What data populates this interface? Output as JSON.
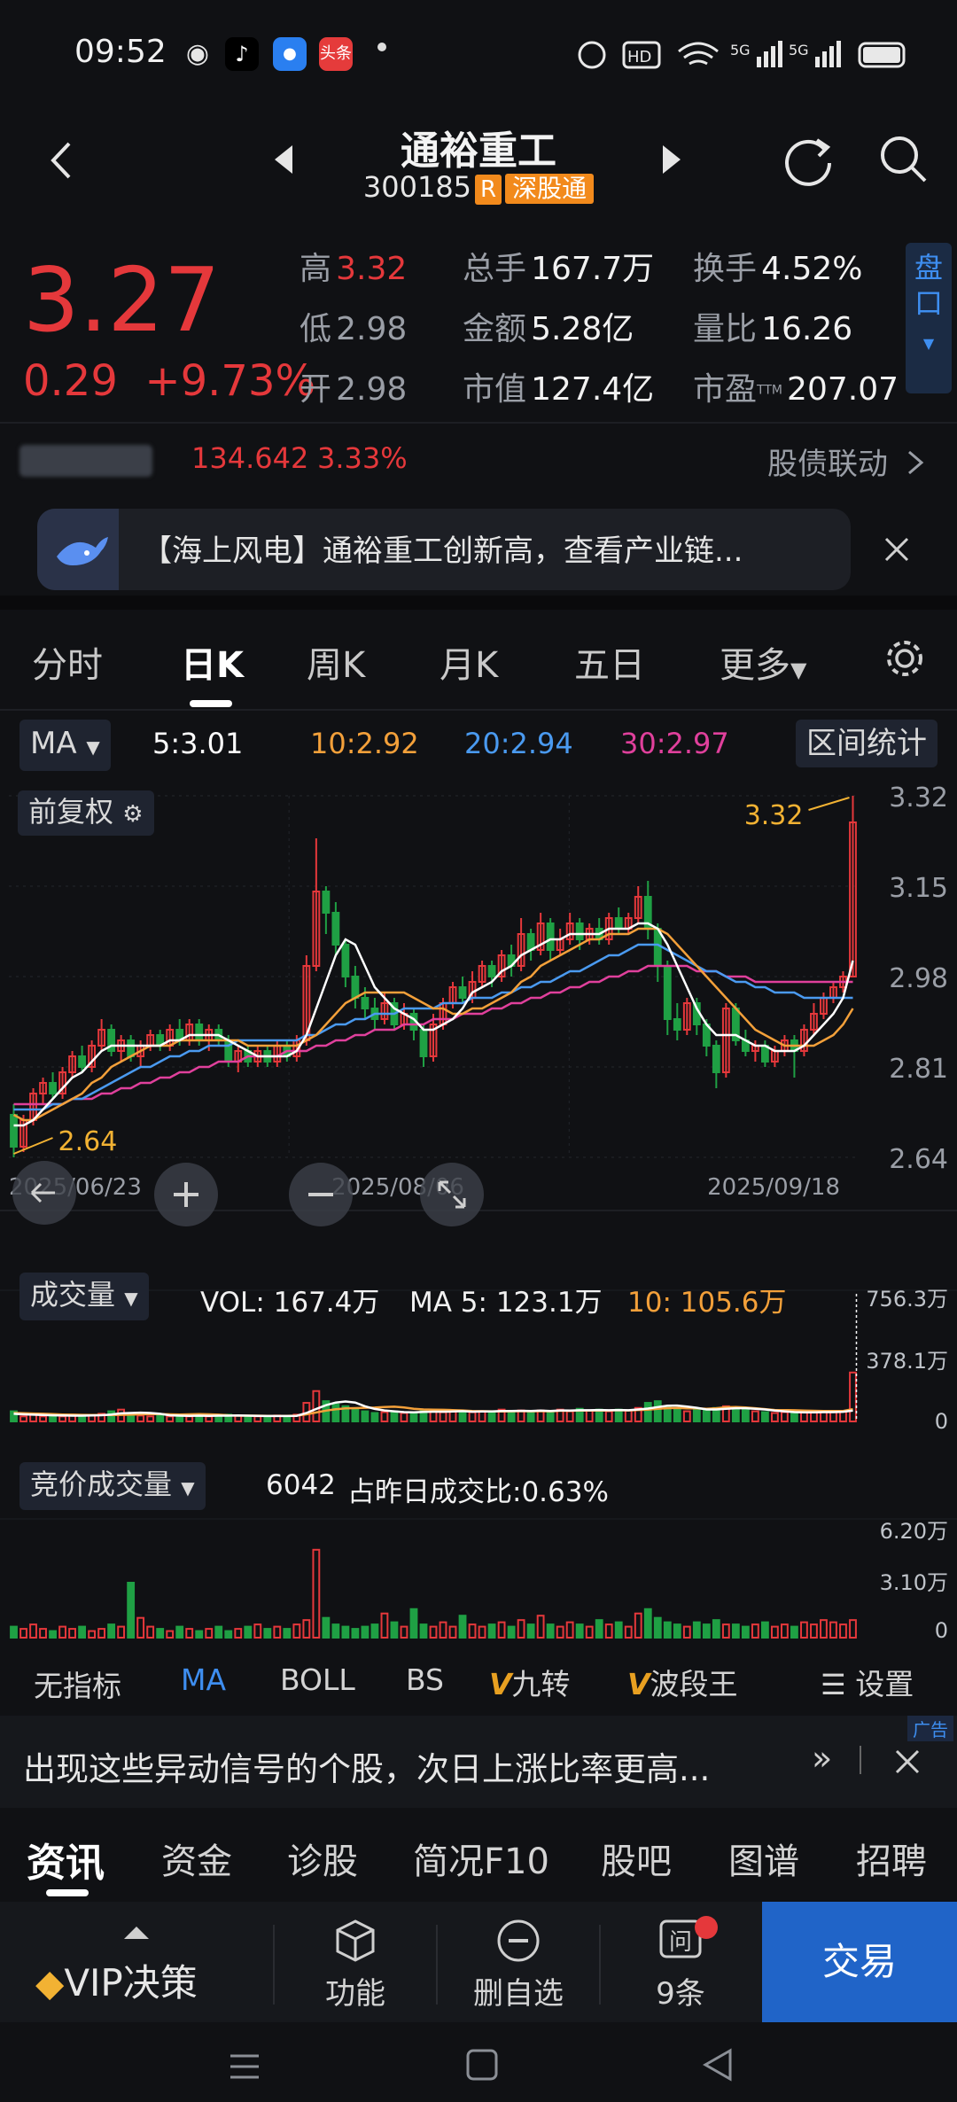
{
  "status": {
    "time": "09:52",
    "app_badge": "头条"
  },
  "header": {
    "title": "通裕重工",
    "code": "300185",
    "badge_r": "R",
    "badge_sgt": "深股通"
  },
  "quote": {
    "price": "3.27",
    "change": "0.29",
    "change_pct": "+9.73%",
    "high_label": "高",
    "high": "3.32",
    "low_label": "低",
    "low": "2.98",
    "open_label": "开",
    "open": "2.98",
    "vol_label": "总手",
    "vol": "167.7万",
    "amt_label": "金额",
    "amt": "5.28亿",
    "mcap_label": "市值",
    "mcap": "127.4亿",
    "turnover_label": "换手",
    "turnover": "4.52%",
    "vratio_label": "量比",
    "vratio": "16.26",
    "pe_label": "市盈",
    "pe_sup": "TTM",
    "pe": "207.07",
    "pankou": "盘口"
  },
  "bond": {
    "price": "134.642",
    "pct": "3.33%",
    "link": "股债联动"
  },
  "news": {
    "text": "【海上风电】通裕重工创新高，查看产业链..."
  },
  "tabs": [
    "分时",
    "日K",
    "周K",
    "月K",
    "五日",
    "更多"
  ],
  "ma": {
    "label": "MA",
    "ma5": "5:3.01",
    "ma10": "10:2.92",
    "ma20": "20:2.94",
    "ma30": "30:2.97",
    "range_btn": "区间统计",
    "fuquan": "前复权",
    "max_label": "3.32",
    "min_label": "2.64"
  },
  "colors": {
    "up": "#e5383b",
    "down": "#1fa044",
    "ma5": "#ffffff",
    "ma10": "#f3a03a",
    "ma20": "#4a9af0",
    "ma30": "#e0409c",
    "accent": "#3e8ef0"
  },
  "chart_data": {
    "type": "candlestick",
    "y_ticks": [
      "3.32",
      "3.15",
      "2.98",
      "2.81",
      "2.64"
    ],
    "ylim": [
      2.64,
      3.32
    ],
    "x_labels": [
      "2025/06/23",
      "2025/08/06",
      "2025/09/18"
    ],
    "candles": [
      [
        2.72,
        2.66,
        2.74,
        2.64
      ],
      [
        2.66,
        2.71,
        2.72,
        2.65
      ],
      [
        2.71,
        2.76,
        2.77,
        2.7
      ],
      [
        2.76,
        2.78,
        2.79,
        2.74
      ],
      [
        2.78,
        2.76,
        2.8,
        2.75
      ],
      [
        2.76,
        2.8,
        2.81,
        2.75
      ],
      [
        2.8,
        2.83,
        2.84,
        2.79
      ],
      [
        2.83,
        2.81,
        2.85,
        2.8
      ],
      [
        2.81,
        2.85,
        2.86,
        2.8
      ],
      [
        2.85,
        2.88,
        2.9,
        2.84
      ],
      [
        2.88,
        2.84,
        2.89,
        2.83
      ],
      [
        2.84,
        2.86,
        2.87,
        2.82
      ],
      [
        2.86,
        2.83,
        2.87,
        2.82
      ],
      [
        2.83,
        2.85,
        2.86,
        2.81
      ],
      [
        2.85,
        2.87,
        2.88,
        2.84
      ],
      [
        2.87,
        2.85,
        2.88,
        2.84
      ],
      [
        2.85,
        2.88,
        2.89,
        2.84
      ],
      [
        2.88,
        2.86,
        2.9,
        2.85
      ],
      [
        2.86,
        2.89,
        2.9,
        2.85
      ],
      [
        2.89,
        2.86,
        2.9,
        2.85
      ],
      [
        2.86,
        2.88,
        2.89,
        2.84
      ],
      [
        2.88,
        2.86,
        2.89,
        2.85
      ],
      [
        2.86,
        2.82,
        2.87,
        2.81
      ],
      [
        2.82,
        2.84,
        2.85,
        2.8
      ],
      [
        2.84,
        2.82,
        2.85,
        2.81
      ],
      [
        2.82,
        2.84,
        2.85,
        2.81
      ],
      [
        2.84,
        2.82,
        2.85,
        2.81
      ],
      [
        2.82,
        2.85,
        2.86,
        2.81
      ],
      [
        2.85,
        2.83,
        2.86,
        2.82
      ],
      [
        2.83,
        2.86,
        2.87,
        2.82
      ],
      [
        2.86,
        3.0,
        3.02,
        2.85
      ],
      [
        3.0,
        3.14,
        3.24,
        2.99
      ],
      [
        3.14,
        3.1,
        3.15,
        3.06
      ],
      [
        3.1,
        3.04,
        3.12,
        3.02
      ],
      [
        3.04,
        2.98,
        3.05,
        2.96
      ],
      [
        2.98,
        2.94,
        3.0,
        2.92
      ],
      [
        2.94,
        2.92,
        2.96,
        2.9
      ],
      [
        2.92,
        2.9,
        2.94,
        2.88
      ],
      [
        2.9,
        2.93,
        2.95,
        2.89
      ],
      [
        2.93,
        2.89,
        2.94,
        2.88
      ],
      [
        2.89,
        2.91,
        2.93,
        2.88
      ],
      [
        2.91,
        2.88,
        2.92,
        2.86
      ],
      [
        2.88,
        2.83,
        2.89,
        2.81
      ],
      [
        2.83,
        2.89,
        2.91,
        2.82
      ],
      [
        2.89,
        2.93,
        2.94,
        2.88
      ],
      [
        2.93,
        2.96,
        2.97,
        2.92
      ],
      [
        2.96,
        2.94,
        2.98,
        2.93
      ],
      [
        2.94,
        2.97,
        2.99,
        2.93
      ],
      [
        2.97,
        3.0,
        3.01,
        2.96
      ],
      [
        3.0,
        2.98,
        3.01,
        2.96
      ],
      [
        2.98,
        3.02,
        3.03,
        2.97
      ],
      [
        3.02,
        3.0,
        3.04,
        2.98
      ],
      [
        3.0,
        3.06,
        3.09,
        2.99
      ],
      [
        3.06,
        3.03,
        3.07,
        3.01
      ],
      [
        3.03,
        3.08,
        3.1,
        3.02
      ],
      [
        3.08,
        3.03,
        3.09,
        3.01
      ],
      [
        3.03,
        3.05,
        3.07,
        3.02
      ],
      [
        3.05,
        3.08,
        3.1,
        3.04
      ],
      [
        3.08,
        3.05,
        3.09,
        3.03
      ],
      [
        3.05,
        3.07,
        3.08,
        3.04
      ],
      [
        3.07,
        3.05,
        3.09,
        3.04
      ],
      [
        3.05,
        3.09,
        3.1,
        3.04
      ],
      [
        3.09,
        3.07,
        3.11,
        3.06
      ],
      [
        3.07,
        3.09,
        3.1,
        3.06
      ],
      [
        3.09,
        3.13,
        3.15,
        3.08
      ],
      [
        3.13,
        3.07,
        3.16,
        3.05
      ],
      [
        3.07,
        3.0,
        3.08,
        2.97
      ],
      [
        3.0,
        2.9,
        3.01,
        2.87
      ],
      [
        2.9,
        2.88,
        2.93,
        2.86
      ],
      [
        2.88,
        2.93,
        2.94,
        2.87
      ],
      [
        2.93,
        2.89,
        2.94,
        2.87
      ],
      [
        2.89,
        2.85,
        2.9,
        2.83
      ],
      [
        2.85,
        2.8,
        2.86,
        2.77
      ],
      [
        2.8,
        2.92,
        2.93,
        2.79
      ],
      [
        2.92,
        2.86,
        2.93,
        2.85
      ],
      [
        2.86,
        2.84,
        2.88,
        2.83
      ],
      [
        2.84,
        2.85,
        2.86,
        2.82
      ],
      [
        2.85,
        2.82,
        2.86,
        2.81
      ],
      [
        2.82,
        2.84,
        2.85,
        2.81
      ],
      [
        2.84,
        2.86,
        2.87,
        2.83
      ],
      [
        2.86,
        2.84,
        2.87,
        2.79
      ],
      [
        2.84,
        2.88,
        2.89,
        2.83
      ],
      [
        2.88,
        2.91,
        2.93,
        2.87
      ],
      [
        2.91,
        2.94,
        2.95,
        2.9
      ],
      [
        2.94,
        2.96,
        2.97,
        2.93
      ],
      [
        2.96,
        2.98,
        2.99,
        2.95
      ],
      [
        2.98,
        3.27,
        3.32,
        2.98
      ]
    ],
    "ma5": [
      2.7,
      2.7,
      2.71,
      2.73,
      2.75,
      2.77,
      2.79,
      2.8,
      2.82,
      2.84,
      2.85,
      2.85,
      2.85,
      2.85,
      2.85,
      2.85,
      2.86,
      2.86,
      2.87,
      2.87,
      2.87,
      2.87,
      2.86,
      2.85,
      2.84,
      2.83,
      2.83,
      2.83,
      2.83,
      2.84,
      2.87,
      2.92,
      2.97,
      3.02,
      3.05,
      3.04,
      3.0,
      2.96,
      2.94,
      2.92,
      2.91,
      2.9,
      2.88,
      2.88,
      2.89,
      2.9,
      2.92,
      2.95,
      2.96,
      2.97,
      2.99,
      3.0,
      3.02,
      3.03,
      3.04,
      3.05,
      3.05,
      3.06,
      3.06,
      3.06,
      3.06,
      3.07,
      3.07,
      3.07,
      3.08,
      3.08,
      3.07,
      3.04,
      3.0,
      2.96,
      2.92,
      2.89,
      2.87,
      2.87,
      2.87,
      2.86,
      2.85,
      2.85,
      2.84,
      2.84,
      2.84,
      2.85,
      2.87,
      2.89,
      2.91,
      2.94,
      3.01
    ],
    "ma10": [
      2.72,
      2.71,
      2.71,
      2.72,
      2.73,
      2.74,
      2.75,
      2.76,
      2.78,
      2.79,
      2.81,
      2.82,
      2.83,
      2.84,
      2.85,
      2.85,
      2.85,
      2.86,
      2.86,
      2.86,
      2.86,
      2.86,
      2.86,
      2.86,
      2.85,
      2.85,
      2.85,
      2.85,
      2.85,
      2.85,
      2.86,
      2.87,
      2.89,
      2.91,
      2.93,
      2.94,
      2.95,
      2.95,
      2.95,
      2.95,
      2.95,
      2.94,
      2.93,
      2.92,
      2.92,
      2.91,
      2.91,
      2.92,
      2.92,
      2.93,
      2.94,
      2.95,
      2.97,
      2.98,
      3.0,
      3.01,
      3.02,
      3.03,
      3.04,
      3.05,
      3.05,
      3.06,
      3.06,
      3.06,
      3.07,
      3.07,
      3.07,
      3.06,
      3.04,
      3.02,
      3.0,
      2.98,
      2.96,
      2.94,
      2.92,
      2.9,
      2.88,
      2.87,
      2.86,
      2.85,
      2.85,
      2.85,
      2.85,
      2.86,
      2.87,
      2.89,
      2.92
    ],
    "ma20": [
      2.73,
      2.73,
      2.73,
      2.73,
      2.74,
      2.74,
      2.75,
      2.75,
      2.76,
      2.77,
      2.78,
      2.79,
      2.8,
      2.81,
      2.81,
      2.82,
      2.83,
      2.83,
      2.84,
      2.84,
      2.85,
      2.85,
      2.85,
      2.86,
      2.86,
      2.86,
      2.86,
      2.86,
      2.86,
      2.86,
      2.87,
      2.87,
      2.88,
      2.89,
      2.89,
      2.9,
      2.9,
      2.91,
      2.91,
      2.91,
      2.92,
      2.92,
      2.92,
      2.92,
      2.93,
      2.93,
      2.93,
      2.94,
      2.94,
      2.94,
      2.95,
      2.95,
      2.96,
      2.96,
      2.97,
      2.97,
      2.98,
      2.99,
      2.99,
      3.0,
      3.01,
      3.02,
      3.02,
      3.03,
      3.04,
      3.04,
      3.04,
      3.03,
      3.02,
      3.01,
      3.0,
      2.99,
      2.99,
      2.98,
      2.97,
      2.97,
      2.96,
      2.96,
      2.95,
      2.95,
      2.95,
      2.94,
      2.94,
      2.94,
      2.94,
      2.94,
      2.94
    ],
    "ma30": [
      2.74,
      2.74,
      2.74,
      2.74,
      2.74,
      2.74,
      2.75,
      2.75,
      2.75,
      2.76,
      2.76,
      2.77,
      2.77,
      2.78,
      2.78,
      2.79,
      2.79,
      2.8,
      2.8,
      2.81,
      2.81,
      2.82,
      2.82,
      2.82,
      2.83,
      2.83,
      2.83,
      2.83,
      2.84,
      2.84,
      2.84,
      2.85,
      2.85,
      2.86,
      2.86,
      2.87,
      2.87,
      2.88,
      2.88,
      2.88,
      2.89,
      2.89,
      2.89,
      2.9,
      2.9,
      2.9,
      2.91,
      2.91,
      2.91,
      2.92,
      2.92,
      2.93,
      2.93,
      2.94,
      2.94,
      2.95,
      2.95,
      2.96,
      2.96,
      2.97,
      2.97,
      2.98,
      2.98,
      2.99,
      2.99,
      3.0,
      3.0,
      3.0,
      3.0,
      3.0,
      2.99,
      2.99,
      2.99,
      2.98,
      2.98,
      2.98,
      2.97,
      2.97,
      2.97,
      2.97,
      2.97,
      2.97,
      2.97,
      2.97,
      2.97,
      2.97,
      2.97
    ],
    "volume": [
      60,
      30,
      40,
      30,
      35,
      30,
      40,
      30,
      35,
      45,
      60,
      70,
      40,
      35,
      30,
      35,
      30,
      40,
      30,
      35,
      30,
      30,
      40,
      35,
      30,
      30,
      30,
      35,
      30,
      40,
      110,
      180,
      120,
      100,
      90,
      70,
      60,
      50,
      55,
      60,
      50,
      55,
      70,
      60,
      55,
      60,
      60,
      55,
      60,
      60,
      70,
      60,
      65,
      60,
      65,
      60,
      70,
      60,
      75,
      65,
      70,
      60,
      70,
      65,
      80,
      110,
      120,
      90,
      70,
      60,
      70,
      65,
      80,
      90,
      80,
      70,
      60,
      55,
      50,
      55,
      50,
      55,
      60,
      55,
      55,
      60,
      290
    ],
    "vol_ma5": [
      45,
      42,
      40,
      38,
      36,
      35,
      34,
      34,
      35,
      37,
      41,
      48,
      50,
      52,
      50,
      45,
      36,
      34,
      33,
      34,
      33,
      34,
      34,
      35,
      34,
      33,
      32,
      32,
      32,
      33,
      50,
      74,
      96,
      112,
      118,
      112,
      90,
      74,
      65,
      60,
      55,
      54,
      56,
      58,
      58,
      59,
      61,
      58,
      59,
      59,
      62,
      62,
      63,
      62,
      64,
      62,
      65,
      64,
      66,
      66,
      68,
      66,
      68,
      66,
      71,
      76,
      85,
      93,
      94,
      88,
      81,
      71,
      71,
      75,
      78,
      78,
      75,
      71,
      64,
      60,
      55,
      54,
      54,
      55,
      55,
      57,
      64
    ],
    "vol_ma10": [
      50,
      49,
      47,
      45,
      43,
      41,
      40,
      39,
      38,
      38,
      38,
      39,
      40,
      42,
      43,
      43,
      42,
      41,
      42,
      43,
      42,
      40,
      36,
      34,
      34,
      34,
      33,
      33,
      33,
      34,
      42,
      53,
      64,
      72,
      77,
      79,
      81,
      82,
      85,
      87,
      83,
      75,
      71,
      70,
      69,
      67,
      65,
      62,
      61,
      60,
      59,
      60,
      61,
      60,
      61,
      60,
      63,
      63,
      64,
      64,
      65,
      64,
      66,
      65,
      68,
      70,
      75,
      79,
      80,
      77,
      77,
      75,
      78,
      84,
      85,
      83,
      78,
      73,
      68,
      67,
      66,
      64,
      63,
      62,
      62,
      62,
      73
    ],
    "vol_axis": [
      "756.3万",
      "378.1万",
      "0"
    ],
    "auction": [
      10,
      8,
      12,
      8,
      6,
      10,
      8,
      10,
      6,
      8,
      12,
      10,
      50,
      18,
      10,
      8,
      6,
      10,
      8,
      6,
      8,
      10,
      6,
      8,
      10,
      12,
      8,
      10,
      8,
      12,
      16,
      80,
      18,
      12,
      10,
      8,
      10,
      12,
      22,
      14,
      10,
      26,
      12,
      10,
      14,
      10,
      20,
      12,
      10,
      12,
      14,
      10,
      16,
      12,
      20,
      12,
      10,
      14,
      12,
      10,
      16,
      12,
      14,
      10,
      22,
      26,
      18,
      14,
      12,
      10,
      14,
      12,
      16,
      12,
      12,
      10,
      12,
      14,
      10,
      12,
      10,
      14,
      12,
      16,
      14,
      12,
      16
    ],
    "auction_axis": [
      "6.20万",
      "3.10万",
      "0"
    ]
  },
  "volume_panel": {
    "label": "成交量",
    "vol": "VOL: 167.4万",
    "ma5": "MA 5: 123.1万",
    "ma10": "10: 105.6万"
  },
  "auction_panel": {
    "label": "竞价成交量",
    "value": "6042",
    "ratio": "占昨日成交比:0.63%"
  },
  "indicators": {
    "items": [
      "无指标",
      "MA",
      "BOLL",
      "BS",
      "九转",
      "波段王"
    ],
    "settings": "设置"
  },
  "ad": {
    "text": "出现这些异动信号的个股，次日上涨比率更高...",
    "tag": "广告"
  },
  "info_tabs": [
    "资讯",
    "资金",
    "诊股",
    "简况F10",
    "股吧",
    "图谱",
    "招聘"
  ],
  "bottom": {
    "vip": "VIP决策",
    "func": "功能",
    "remove": "删自选",
    "msg": "9条",
    "trade": "交易"
  }
}
